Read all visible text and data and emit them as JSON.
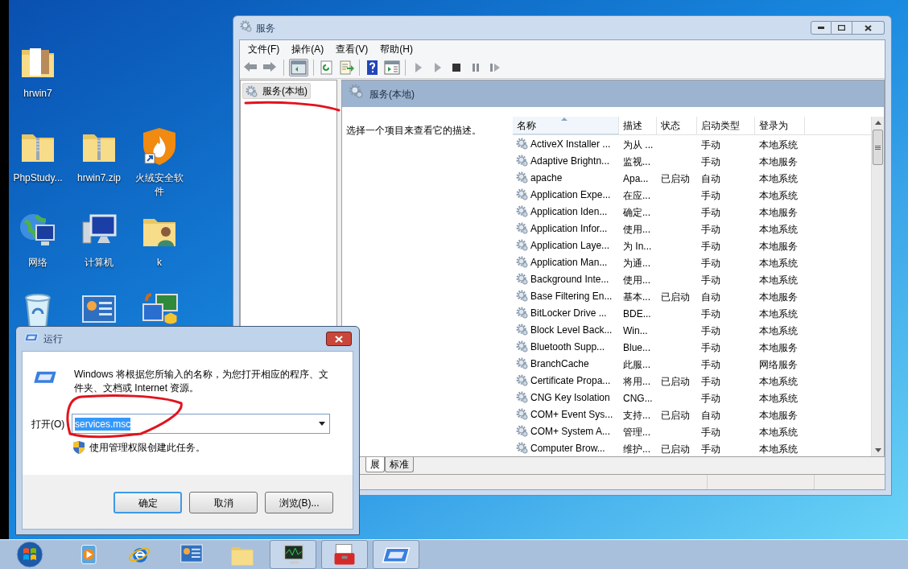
{
  "desktop_icons": [
    {
      "kind": "folder",
      "label": "hrwin7"
    },
    {
      "kind": "zip-folder",
      "label": "PhpStudy..."
    },
    {
      "kind": "zip-folder",
      "label": "hrwin7.zip"
    },
    {
      "kind": "shield-shortcut",
      "label": "火绒安全软件"
    },
    {
      "kind": "network",
      "label": "网络"
    },
    {
      "kind": "computer",
      "label": "计算机"
    },
    {
      "kind": "user-folder",
      "label": "k"
    },
    {
      "kind": "recycle-bin"
    },
    {
      "kind": "control-panel"
    },
    {
      "kind": "transfer-shortcut"
    }
  ],
  "services_window": {
    "title": "服务",
    "menu": [
      "文件(F)",
      "操作(A)",
      "查看(V)",
      "帮助(H)"
    ],
    "tree": [
      {
        "label": "服务(本地)",
        "selected": true
      }
    ],
    "header_title": "服务(本地)",
    "description_prompt": "选择一个项目来查看它的描述。",
    "columns": [
      "名称",
      "描述",
      "状态",
      "启动类型",
      "登录为"
    ],
    "rows": [
      {
        "name": "ActiveX Installer ...",
        "description": "为从 ...",
        "startup_type": "手动",
        "log_on_as": "本地系统"
      },
      {
        "name": "Adaptive Brightn...",
        "description": "监视...",
        "startup_type": "手动",
        "log_on_as": "本地服务"
      },
      {
        "name": "apache",
        "description": "Apa...",
        "status": "已启动",
        "startup_type": "自动",
        "log_on_as": "本地系统"
      },
      {
        "name": "Application Expe...",
        "description": "在应...",
        "startup_type": "手动",
        "log_on_as": "本地系统"
      },
      {
        "name": "Application Iden...",
        "description": "确定...",
        "startup_type": "手动",
        "log_on_as": "本地服务"
      },
      {
        "name": "Application Infor...",
        "description": "使用...",
        "startup_type": "手动",
        "log_on_as": "本地系统"
      },
      {
        "name": "Application Laye...",
        "description": "为 In...",
        "startup_type": "手动",
        "log_on_as": "本地服务"
      },
      {
        "name": "Application Man...",
        "description": "为通...",
        "startup_type": "手动",
        "log_on_as": "本地系统"
      },
      {
        "name": "Background Inte...",
        "description": "使用...",
        "startup_type": "手动",
        "log_on_as": "本地系统"
      },
      {
        "name": "Base Filtering En...",
        "description": "基本...",
        "status": "已启动",
        "startup_type": "自动",
        "log_on_as": "本地服务"
      },
      {
        "name": "BitLocker Drive ...",
        "description": "BDE...",
        "startup_type": "手动",
        "log_on_as": "本地系统"
      },
      {
        "name": "Block Level Back...",
        "description": "Win...",
        "startup_type": "手动",
        "log_on_as": "本地系统"
      },
      {
        "name": "Bluetooth Supp...",
        "description": "Blue...",
        "startup_type": "手动",
        "log_on_as": "本地服务"
      },
      {
        "name": "BranchCache",
        "description": "此服...",
        "startup_type": "手动",
        "log_on_as": "网络服务"
      },
      {
        "name": "Certificate Propa...",
        "description": "将用...",
        "status": "已启动",
        "startup_type": "手动",
        "log_on_as": "本地系统"
      },
      {
        "name": "CNG Key Isolation",
        "description": "CNG...",
        "startup_type": "手动",
        "log_on_as": "本地系统"
      },
      {
        "name": "COM+ Event Sys...",
        "description": "支持...",
        "status": "已启动",
        "startup_type": "自动",
        "log_on_as": "本地服务"
      },
      {
        "name": "COM+ System A...",
        "description": "管理...",
        "startup_type": "手动",
        "log_on_as": "本地系统"
      },
      {
        "name": "Computer Brow...",
        "description": "维护...",
        "status": "已启动",
        "startup_type": "手动",
        "log_on_as": "本地系统"
      }
    ],
    "tabs": [
      {
        "label": "展",
        "selected": true
      },
      {
        "label": "标准",
        "selected": false
      }
    ]
  },
  "run_dialog": {
    "title": "运行",
    "message": "Windows 将根据您所输入的名称，为您打开相应的程序、文件夹、文档或 Internet 资源。",
    "open_label": "打开(O)",
    "command": "services.msc",
    "admin_note": "使用管理权限创建此任务。",
    "buttons": [
      {
        "label": "确定",
        "default": true
      },
      {
        "label": "取消",
        "default": false
      },
      {
        "label": "浏览(B)...",
        "default": false
      }
    ]
  },
  "taskbar": [
    {
      "kind": "media-player",
      "open": false
    },
    {
      "kind": "browser",
      "open": false
    },
    {
      "kind": "control-panel",
      "open": false
    },
    {
      "kind": "file-explorer",
      "open": false
    },
    {
      "kind": "task-monitor",
      "open": true
    },
    {
      "kind": "toolbox",
      "open": true
    },
    {
      "kind": "run",
      "open": true
    }
  ]
}
